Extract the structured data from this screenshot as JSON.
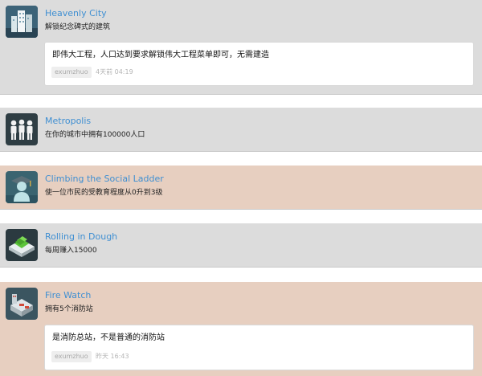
{
  "achievements": [
    {
      "title": "Heavenly City",
      "description": "解锁纪念碑式的建筑",
      "icon": "skyscraper-icon",
      "comment": {
        "text": "即伟大工程，人口达到要求解锁伟大工程菜单即可，无需建造",
        "author": "exumzhuo",
        "time": "4天前 04:19"
      }
    },
    {
      "title": "Metropolis",
      "description": "在你的城市中拥有100000人口",
      "icon": "people-icon"
    },
    {
      "title": "Climbing the Social Ladder",
      "description": "使一位市民的受教育程度从0升到3级",
      "icon": "graduate-icon"
    },
    {
      "title": "Rolling in Dough",
      "description": "每周赚入15000",
      "icon": "money-icon"
    },
    {
      "title": "Fire Watch",
      "description": "拥有5个消防站",
      "icon": "fire-station-icon",
      "comment": {
        "text": "是消防总站，不是普通的消防站",
        "author": "exumzhuo",
        "time": "昨天 16:43"
      }
    }
  ]
}
